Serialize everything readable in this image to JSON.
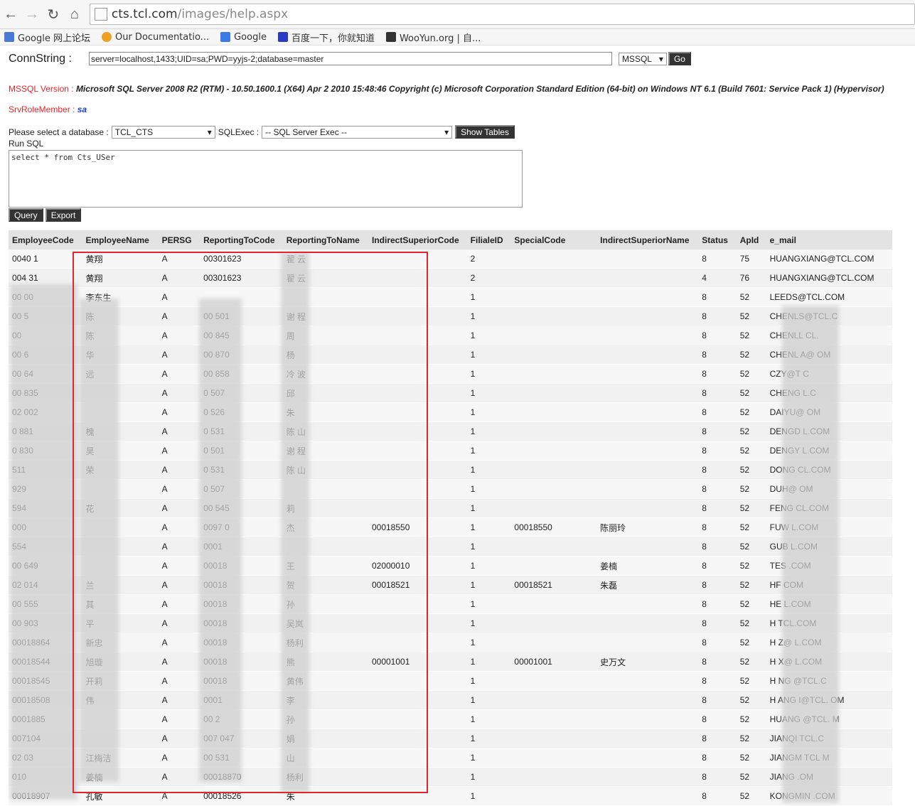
{
  "browser": {
    "url_host": "cts.tcl.com",
    "url_path": "/images/help.aspx",
    "bookmarks": [
      {
        "label": "Google 网上论坛",
        "icon": "google-groups-icon",
        "color": "#4a7ad8"
      },
      {
        "label": "Our Documentatio...",
        "icon": "docs-icon",
        "color": "#f0a020"
      },
      {
        "label": "Google",
        "icon": "google-icon",
        "color": "#3b7be8"
      },
      {
        "label": "百度一下，你就知道",
        "icon": "baidu-icon",
        "color": "#2b3bc8"
      },
      {
        "label": "WooYun.org | 自...",
        "icon": "wooyun-icon",
        "color": "#333333"
      }
    ]
  },
  "conn": {
    "label": "ConnString :",
    "value": "server=localhost,1433;UID=sa;PWD=yyjs-2;database=master",
    "db_type": "MSSQL",
    "go_label": "Go"
  },
  "version": {
    "label": "MSSQL Version :",
    "value": "Microsoft SQL Server 2008 R2 (RTM) - 10.50.1600.1 (X64) Apr 2 2010 15:48:46 Copyright (c) Microsoft Corporation Standard Edition (64-bit) on Windows NT 6.1 (Build 7601: Service Pack 1) (Hypervisor)"
  },
  "role": {
    "label": "SrvRoleMember :",
    "value": "sa"
  },
  "db_select": {
    "label": "Please select a database :",
    "selected": "TCL_CTS",
    "sqlexec_label": "SQLExec :",
    "sqlexec_selected": "-- SQL Server Exec --",
    "show_tables_label": "Show Tables"
  },
  "run_sql": {
    "label": "Run SQL",
    "query": "select * from Cts_USer",
    "query_btn": "Query",
    "export_btn": "Export"
  },
  "table": {
    "columns": [
      "EmployeeCode",
      "EmployeeName",
      "PERSG",
      "ReportingToCode",
      "ReportingToName",
      "IndirectSuperiorCode",
      "FilialeID",
      "SpecialCode",
      "IndirectSuperiorName",
      "Status",
      "ApId",
      "e_mail"
    ],
    "rows": [
      [
        "0040  1",
        "黄翔",
        "A",
        "00301623",
        "翟  云",
        "",
        "2",
        "",
        "",
        "8",
        "75",
        "HUANGXIANG@TCL.COM"
      ],
      [
        "004  31",
        "黄翔",
        "A",
        "00301623",
        "翟  云",
        "",
        "2",
        "",
        "",
        "4",
        "76",
        "HUANGXIANG@TCL.COM"
      ],
      [
        "00  00",
        "李东生",
        "A",
        "",
        "",
        "",
        "1",
        "",
        "",
        "8",
        "52",
        "LEEDS@TCL.COM"
      ],
      [
        "00  5",
        "陈  ",
        "A",
        "00  501",
        "谢  程",
        "",
        "1",
        "",
        "",
        "8",
        "52",
        "CHENLS@TCL.C"
      ],
      [
        "00  ",
        "陈  ",
        "A",
        "00  845",
        "周",
        "",
        "1",
        "",
        "",
        "8",
        "52",
        "CHENLL  CL.  "
      ],
      [
        "00  6",
        "  华",
        "A",
        "00  870",
        "杨",
        "",
        "1",
        "",
        "",
        "8",
        "52",
        "CHENL  A@  OM"
      ],
      [
        "00  64",
        "  远",
        "A",
        "00  858",
        "冷  波",
        "",
        "1",
        "",
        "",
        "8",
        "52",
        "CZY@T  C"
      ],
      [
        "00  835",
        "  ",
        "A",
        "0  507",
        "邱",
        "",
        "1",
        "",
        "",
        "8",
        "52",
        "CHENG  L.C"
      ],
      [
        "02  002",
        "  ",
        "A",
        "0  526",
        "朱",
        "",
        "1",
        "",
        "",
        "8",
        "52",
        "DAIYU@  OM"
      ],
      [
        "0  881",
        "  槐",
        "A",
        "0  531",
        "陈  山",
        "",
        "1",
        "",
        "",
        "8",
        "52",
        "DENGD  L.COM"
      ],
      [
        "0  830",
        "  昊",
        "A",
        "0  501",
        "谢  程",
        "",
        "1",
        "",
        "",
        "8",
        "52",
        "DENGY  L.COM"
      ],
      [
        "  511",
        "  荣",
        "A",
        "0  531",
        "陈  山",
        "",
        "1",
        "",
        "",
        "8",
        "52",
        "DONG  CL.COM"
      ],
      [
        "  929",
        "  ",
        "A",
        "0  507",
        "  ",
        "",
        "1",
        "",
        "",
        "8",
        "52",
        "DUH@  OM"
      ],
      [
        "  594",
        "  花",
        "A",
        "00  545",
        "  莉",
        "",
        "1",
        "",
        "",
        "8",
        "52",
        "FENG  CL.COM"
      ],
      [
        "  000",
        "  ",
        "A",
        "0097  0",
        "  杰",
        "00018550",
        "1",
        "00018550",
        "陈丽玲",
        "8",
        "52",
        "FUW  L.COM"
      ],
      [
        "  554",
        "  ",
        "A",
        "0001  ",
        "  ",
        "",
        "1",
        "",
        "",
        "8",
        "52",
        "GUB  L.COM"
      ],
      [
        "00  649",
        "  ",
        "A",
        "00018",
        "王  ",
        "02000010",
        "1",
        "",
        "姜楠",
        "8",
        "52",
        "TES  .COM"
      ],
      [
        "02  014",
        "  兰",
        "A",
        "00018",
        "贺  ",
        "00018521",
        "1",
        "00018521",
        "朱磊",
        "8",
        "52",
        "HF  COM"
      ],
      [
        "00  555",
        "  其",
        "A",
        "00018",
        "孙  ",
        "",
        "1",
        "",
        "",
        "8",
        "52",
        "HE  L.COM"
      ],
      [
        "00  903",
        "  平",
        "A",
        "00018",
        "吴岚",
        "",
        "1",
        "",
        "",
        "8",
        "52",
        "H  TCL.COM"
      ],
      [
        "00018864",
        "  新忠",
        "A",
        "00018",
        "杨利",
        "",
        "1",
        "",
        "",
        "8",
        "52",
        "H  Z@  L.COM"
      ],
      [
        "00018544",
        "  旭璇",
        "A",
        "00018",
        "熊  ",
        "00001001",
        "1",
        "00001001",
        "史万文",
        "8",
        "52",
        "H  X@  L.COM"
      ],
      [
        "00018545",
        "  开莉",
        "A",
        "00018",
        "黄伟",
        "",
        "1",
        "",
        "",
        "8",
        "52",
        "H  NG  @TCL.C  "
      ],
      [
        "00018508",
        "  伟",
        "A",
        "0001  ",
        "李  ",
        "",
        "1",
        "",
        "",
        "8",
        "52",
        "H  ANG  I@TCL.  OM"
      ],
      [
        "0001885",
        "  ",
        "A",
        "00  2",
        "孙  ",
        "",
        "1",
        "",
        "",
        "8",
        "52",
        "HUANG  @TCL.  M"
      ],
      [
        "007104",
        "  ",
        "A",
        "007  047",
        "  娟",
        "",
        "1",
        "",
        "",
        "8",
        "52",
        "JIANQI  TCL.C  "
      ],
      [
        "02  03",
        "江梅洁",
        "A",
        "00  531",
        "  山",
        "",
        "1",
        "",
        "",
        "8",
        "52",
        "JIANGM  TCL  M"
      ],
      [
        "  010",
        "姜楠",
        "A",
        "00018870",
        "杨利",
        "",
        "1",
        "",
        "",
        "8",
        "52",
        "JIANG  .OM"
      ],
      [
        "00018907",
        "孔敏",
        "A",
        "00018526",
        "朱  ",
        "",
        "1",
        "",
        "",
        "8",
        "52",
        "KONGMIN  .COM"
      ]
    ]
  }
}
